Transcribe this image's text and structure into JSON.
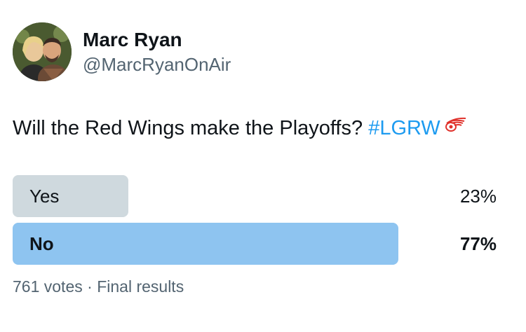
{
  "author": {
    "display_name": "Marc Ryan",
    "handle": "@MarcRyanOnAir"
  },
  "tweet": {
    "text": "Will the Red Wings make the Playoffs? ",
    "hashtag": "#LGRW",
    "emoji_icon": "red-wings-logo-icon"
  },
  "poll": {
    "options": [
      {
        "label": "Yes",
        "percent_label": "23%",
        "percent": 23,
        "winner": false
      },
      {
        "label": "No",
        "percent_label": "77%",
        "percent": 77,
        "winner": true
      }
    ],
    "votes": "761 votes",
    "separator": "·",
    "status": "Final results"
  },
  "colors": {
    "text": "#0f1419",
    "secondary": "#536471",
    "hashtag": "#1d9bf0",
    "bar_loser": "#cfd9de",
    "bar_winner": "#8ec4f0"
  }
}
